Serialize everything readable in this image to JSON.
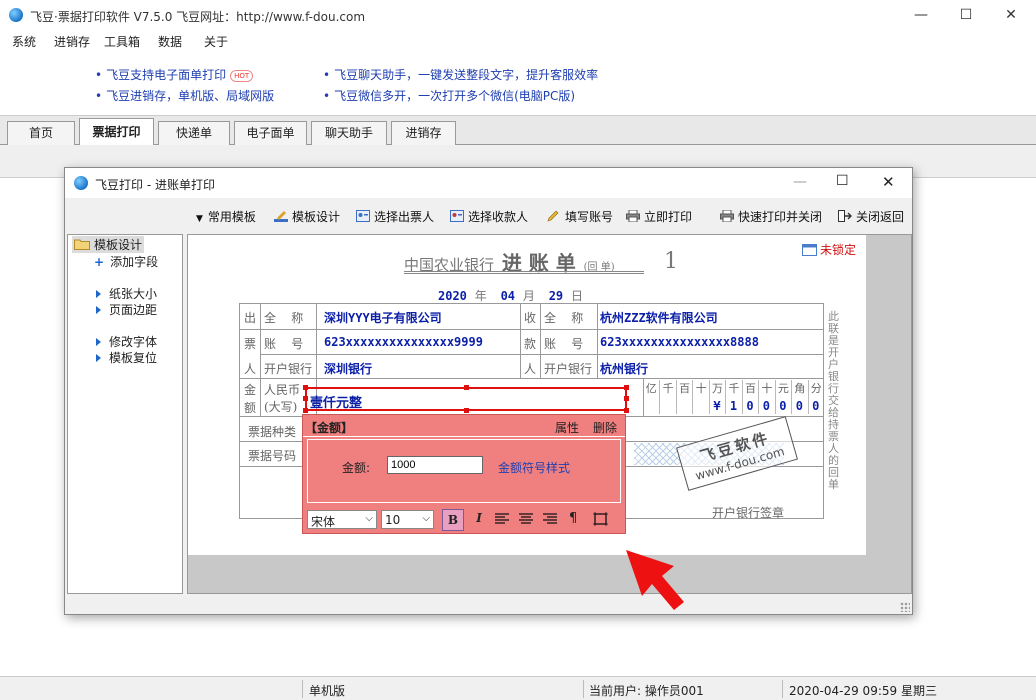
{
  "app": {
    "title": "飞豆·票据打印软件 V7.5.0   飞豆网址：http://www.f-dou.com",
    "window_controls": {
      "minimize": "—",
      "maximize": "☐",
      "close": "✕"
    }
  },
  "menu": [
    "系统",
    "进销存",
    "工具箱",
    "数据",
    "关于"
  ],
  "promos": [
    {
      "text": "飞豆支持电子面单打印",
      "badge": "HOT"
    },
    {
      "text": "飞豆聊天助手，一键发送整段文字，提升客服效率"
    },
    {
      "text": "飞豆进销存，单机版、局域网版"
    },
    {
      "text": "飞豆微信多开，一次打开多个微信(电脑PC版)"
    }
  ],
  "tabs": [
    {
      "label": "首页",
      "active": false
    },
    {
      "label": "票据打印",
      "active": true
    },
    {
      "label": "快递单",
      "active": false
    },
    {
      "label": "电子面单",
      "active": false
    },
    {
      "label": "聊天助手",
      "active": false
    },
    {
      "label": "进销存",
      "active": false
    }
  ],
  "dialog": {
    "title": "飞豆打印 - 进账单打印",
    "toolbar": [
      "常用模板",
      "模板设计",
      "选择出票人",
      "选择收款人",
      "填写账号",
      "立即打印",
      "快速打印并关闭",
      "关闭返回"
    ],
    "tree": {
      "root": "模板设计",
      "items": [
        "添加字段",
        "纸张大小",
        "页面边距",
        "修改字体",
        "模板复位"
      ]
    },
    "lock_status": "未锁定"
  },
  "slip": {
    "bank": "中国农业银行",
    "title": "进 账 单",
    "title_note": "(回    单)",
    "copy_no": "1",
    "date": {
      "year": "2020",
      "year_unit": "年",
      "month": "04",
      "month_unit": "月",
      "day": "29",
      "day_unit": "日"
    },
    "side_labels": {
      "payer": [
        "出",
        "票",
        "人"
      ],
      "payee": [
        "收",
        "款",
        "人"
      ],
      "amount": [
        "金",
        "额"
      ]
    },
    "row_labels": {
      "full_name": "全    称",
      "account": "账    号",
      "bank": "开户银行"
    },
    "payer": {
      "name": "深圳YYY电子有限公司",
      "account": "623xxxxxxxxxxxxxxx9999",
      "bank": "深圳银行"
    },
    "payee": {
      "name": "杭州ZZZ软件有限公司",
      "account": "623xxxxxxxxxxxxxxx8888",
      "bank": "杭州银行"
    },
    "amount_label": [
      "人民币",
      "(大写)"
    ],
    "amount_words": "壹仟元整",
    "digit_headers": [
      "亿",
      "千",
      "百",
      "十",
      "万",
      "千",
      "百",
      "十",
      "元",
      "角",
      "分"
    ],
    "digits": [
      "",
      "",
      "",
      "",
      "¥",
      "1",
      "0",
      "0",
      "0",
      "0",
      "0"
    ],
    "bill_type_label": "票据种类",
    "bill_no_label": "票据号码",
    "stamp_label": "开户银行签章",
    "side_note": [
      "此",
      "联",
      "是",
      "开",
      "户",
      "银",
      "行",
      "交",
      "给",
      "持",
      "票",
      "人",
      "的",
      "回",
      "单"
    ],
    "watermark": {
      "line1": "飞豆软件",
      "line2": "www.f-dou.com"
    }
  },
  "property_panel": {
    "title": "【金额】",
    "attr_label": "属性",
    "delete_label": "删除",
    "field_label": "金额:",
    "field_value": "1000",
    "link": "金额符号样式",
    "font_family": "宋体",
    "font_size": "10"
  },
  "status": {
    "edition": "单机版",
    "user": "当前用户: 操作员001",
    "datetime": "2020-04-29 09:59 星期三"
  },
  "colors": {
    "accent": "#1a66c9",
    "value_blue": "#0b1fa8",
    "select_red": "#e01010",
    "panel_red": "#f07f7f"
  }
}
